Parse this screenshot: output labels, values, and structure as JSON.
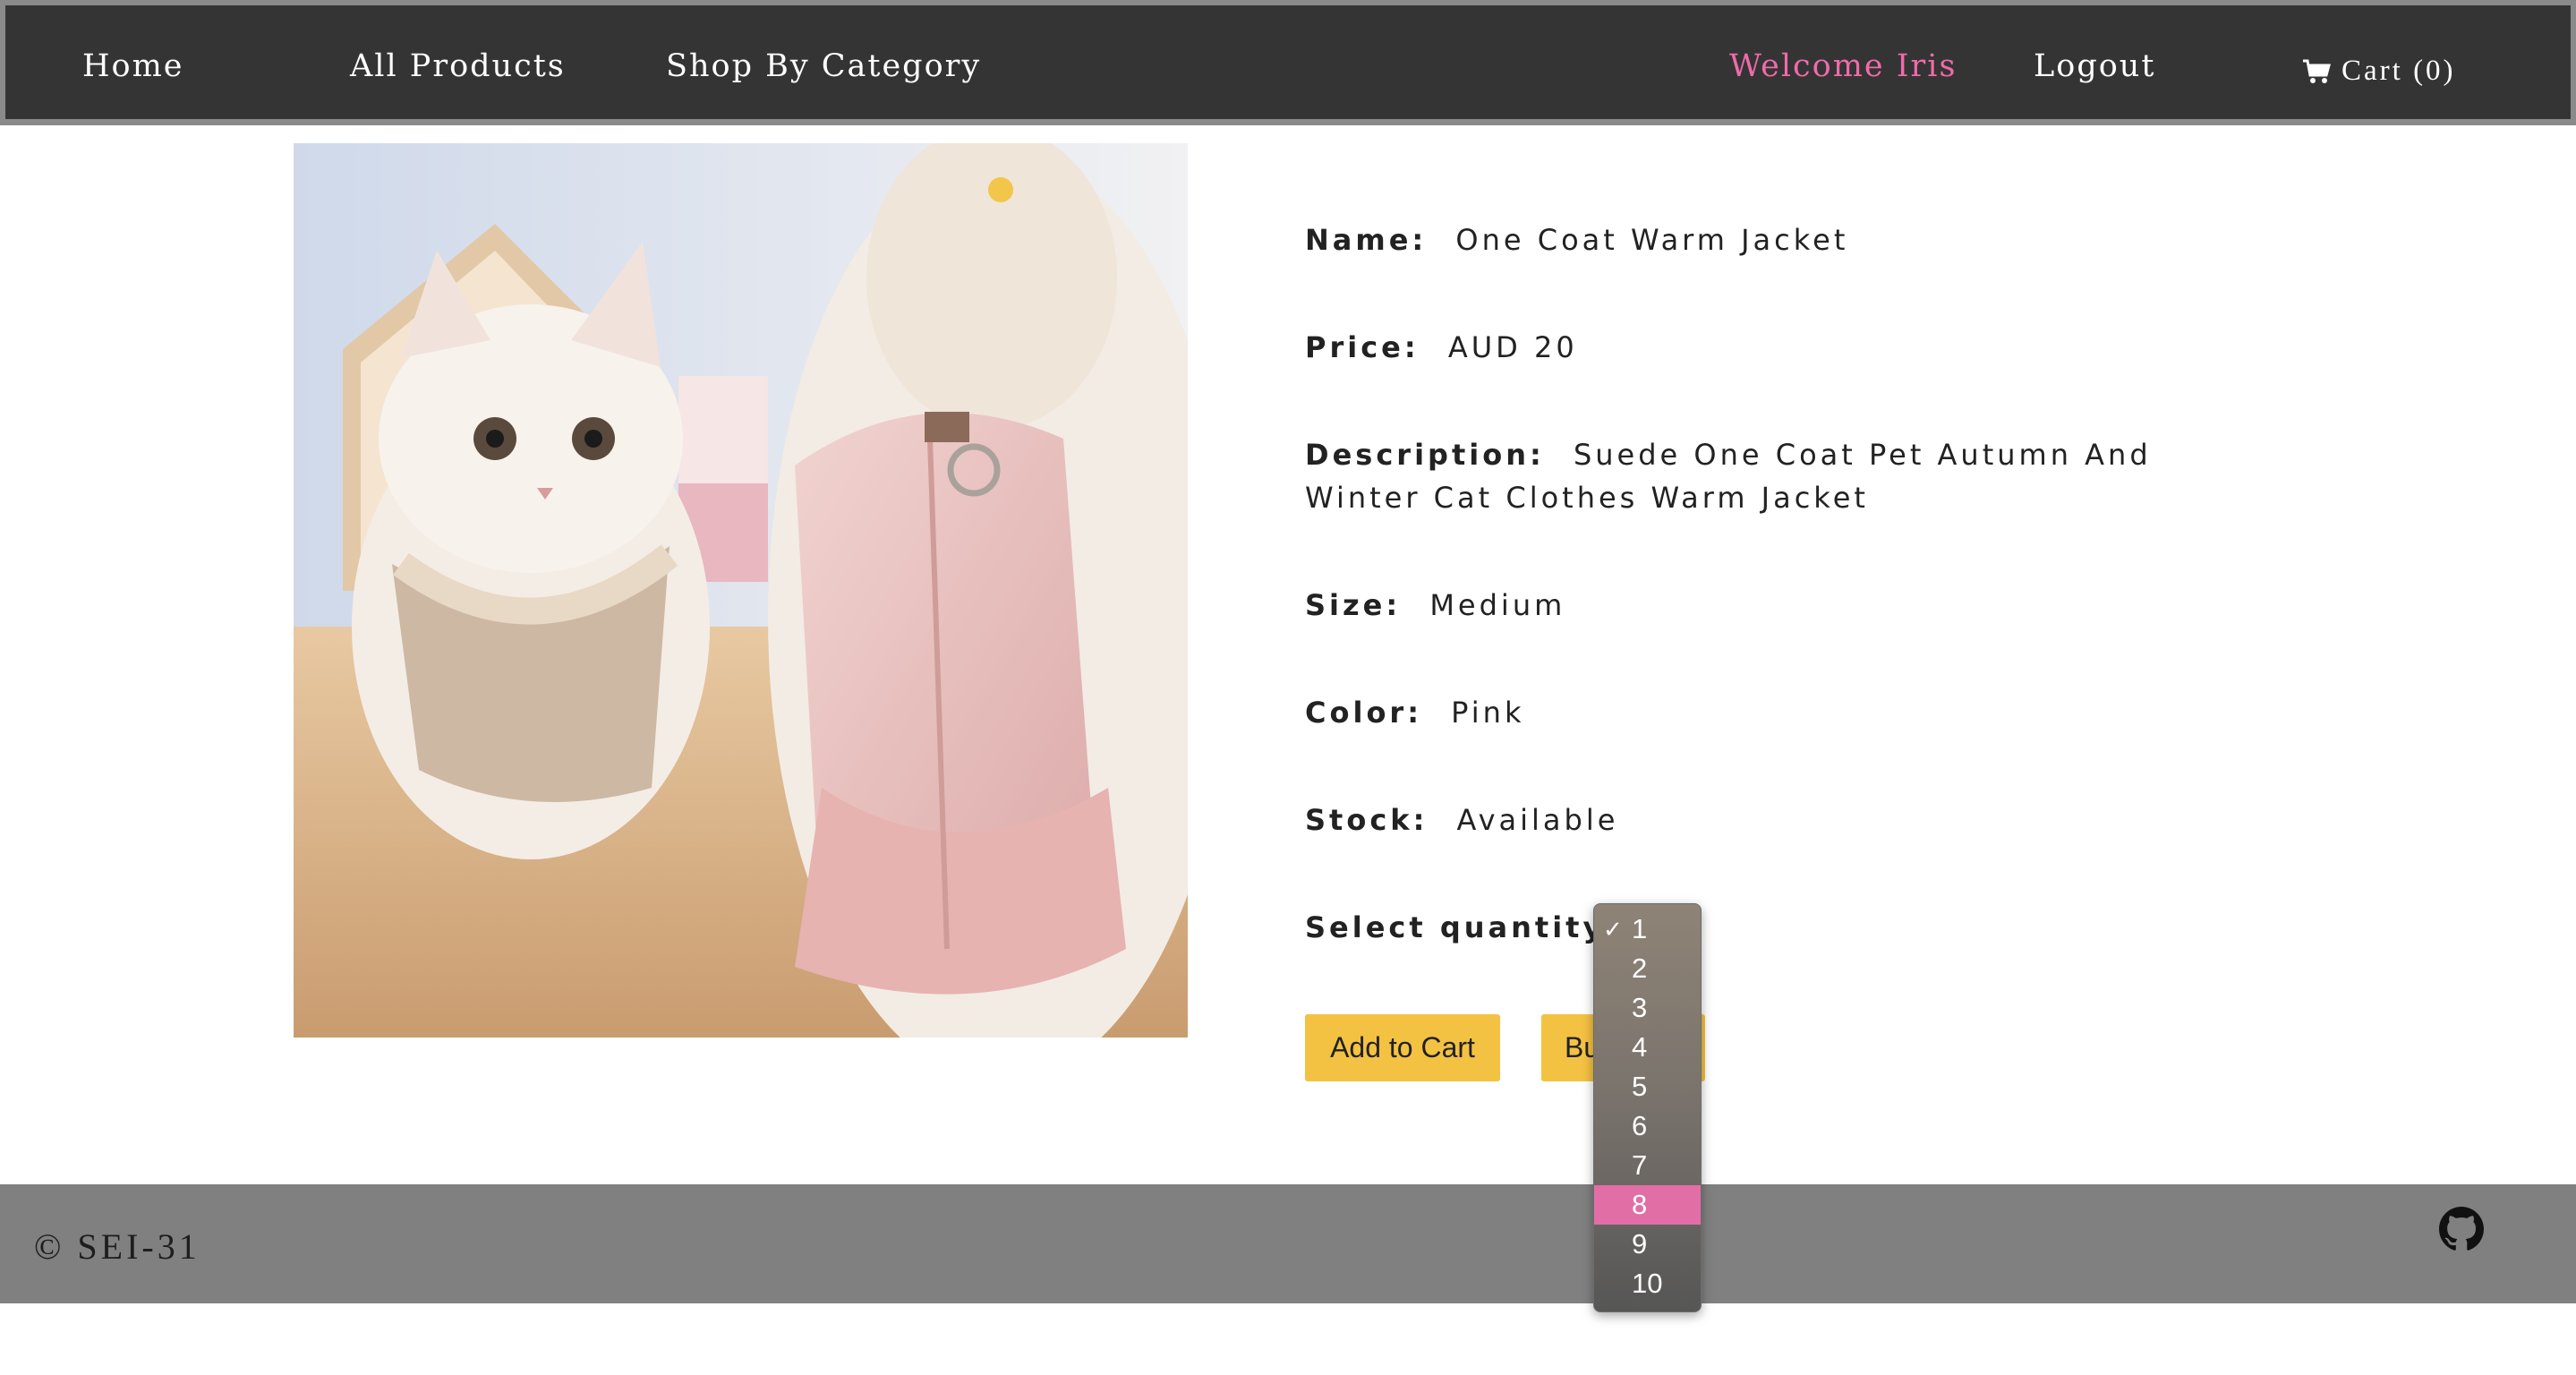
{
  "nav": {
    "home": "Home",
    "all_products": "All Products",
    "shop_by_category": "Shop By Category",
    "welcome": "Welcome Iris",
    "logout": "Logout",
    "cart": "Cart (0)",
    "cart_icon": "shopping-cart-icon"
  },
  "product": {
    "name_label": "Name:",
    "name": "One Coat Warm Jacket",
    "price_label": "Price:",
    "price": "AUD 20",
    "description_label": "Description:",
    "description": "Suede One Coat Pet Autumn And Winter Cat Clothes Warm Jacket",
    "size_label": "Size:",
    "size": "Medium",
    "color_label": "Color:",
    "color": "Pink",
    "stock_label": "Stock:",
    "stock": "Available",
    "quantity_label": "Select quantity:"
  },
  "buttons": {
    "add_to_cart": "Add to Cart",
    "buy_now_visible": "Bu"
  },
  "quantity_dropdown": {
    "selected": "1",
    "highlighted": "8",
    "options": [
      "1",
      "2",
      "3",
      "4",
      "5",
      "6",
      "7",
      "8",
      "9",
      "10"
    ]
  },
  "footer": {
    "copyright": "© SEI-31",
    "github_icon": "github-icon"
  },
  "colors": {
    "nav_bg": "#343434",
    "accent_pink": "#ef6ba8",
    "button_yellow": "#f4c242",
    "footer_bg": "#808080",
    "dropdown_highlight": "#e26ea6"
  }
}
